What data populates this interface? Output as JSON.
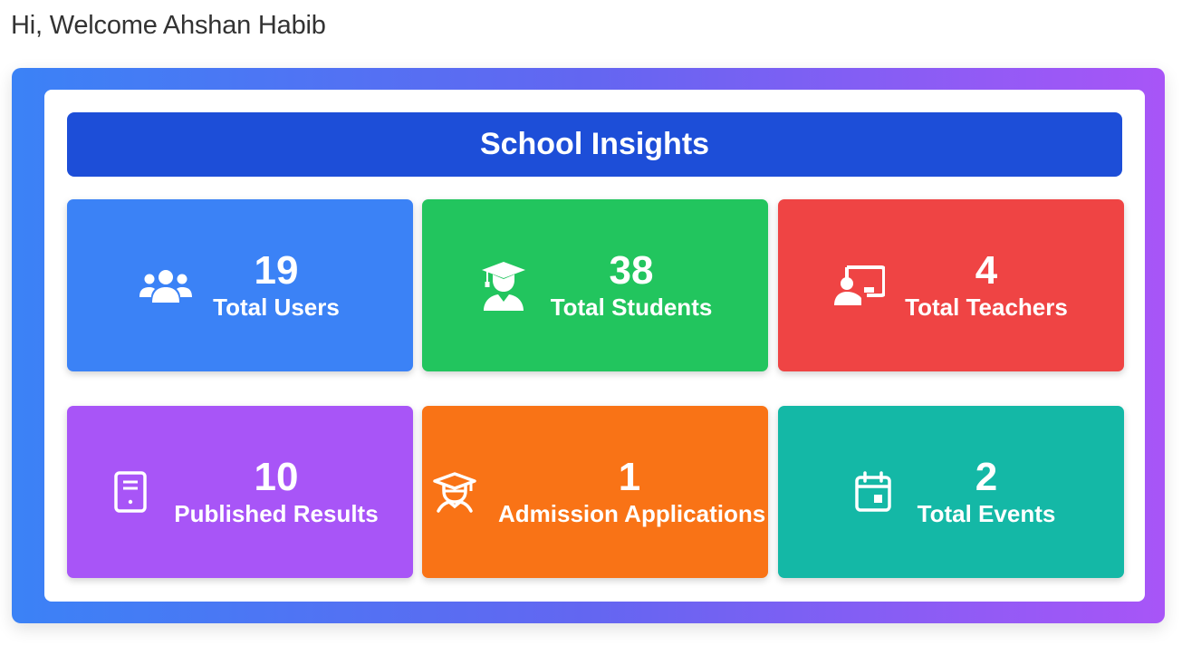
{
  "greeting": "Hi, Welcome Ahshan Habib",
  "panel": {
    "title": "School Insights"
  },
  "colors": {
    "title_bar": "#1d4ed8",
    "gradient_start": "#3b82f6",
    "gradient_end": "#a855f7"
  },
  "stats": [
    {
      "value": "19",
      "label": "Total Users",
      "icon": "users-icon",
      "color": "#3b82f6"
    },
    {
      "value": "38",
      "label": "Total Students",
      "icon": "graduate-icon",
      "color": "#22c55e"
    },
    {
      "value": "4",
      "label": "Total Teachers",
      "icon": "teacher-icon",
      "color": "#ef4444"
    },
    {
      "value": "10",
      "label": "Published Results",
      "icon": "document-icon",
      "color": "#a855f7"
    },
    {
      "value": "1",
      "label": "Admission Applications",
      "icon": "student-cap-icon",
      "color": "#f97316"
    },
    {
      "value": "2",
      "label": "Total Events",
      "icon": "calendar-icon",
      "color": "#14b8a6"
    }
  ]
}
